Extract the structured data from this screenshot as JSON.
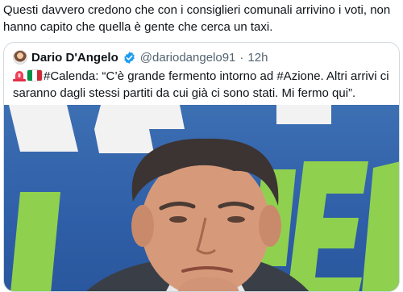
{
  "tweet": {
    "text": "Questi davvero credono che con i consiglieri comunali arrivino i voti, non hanno capito che quella è gente che cerca un taxi."
  },
  "quoted_tweet": {
    "display_name": "Dario D'Angelo",
    "handle": "@dariodangelo91",
    "separator": "·",
    "time": "12h",
    "text": "#Calenda: “C’è grande fermento intorno ad #Azione. Altri arrivi ci saranno dagli stessi partiti da cui già ci sono stati. Mi fermo qui”.",
    "icons": [
      "avatar",
      "verified-badge-icon",
      "rotating-light-icon",
      "italy-flag-icon"
    ]
  },
  "photo": {
    "banner_letters": "AZ LEE",
    "colors": {
      "background": "#2f5fa8",
      "banner_green": "#8fd14f",
      "banner_white": "#f2f2f2"
    }
  },
  "colors": {
    "text": "#0f1419",
    "secondary": "#536471",
    "border": "#cfd9de",
    "verified": "#1d9bf0"
  }
}
